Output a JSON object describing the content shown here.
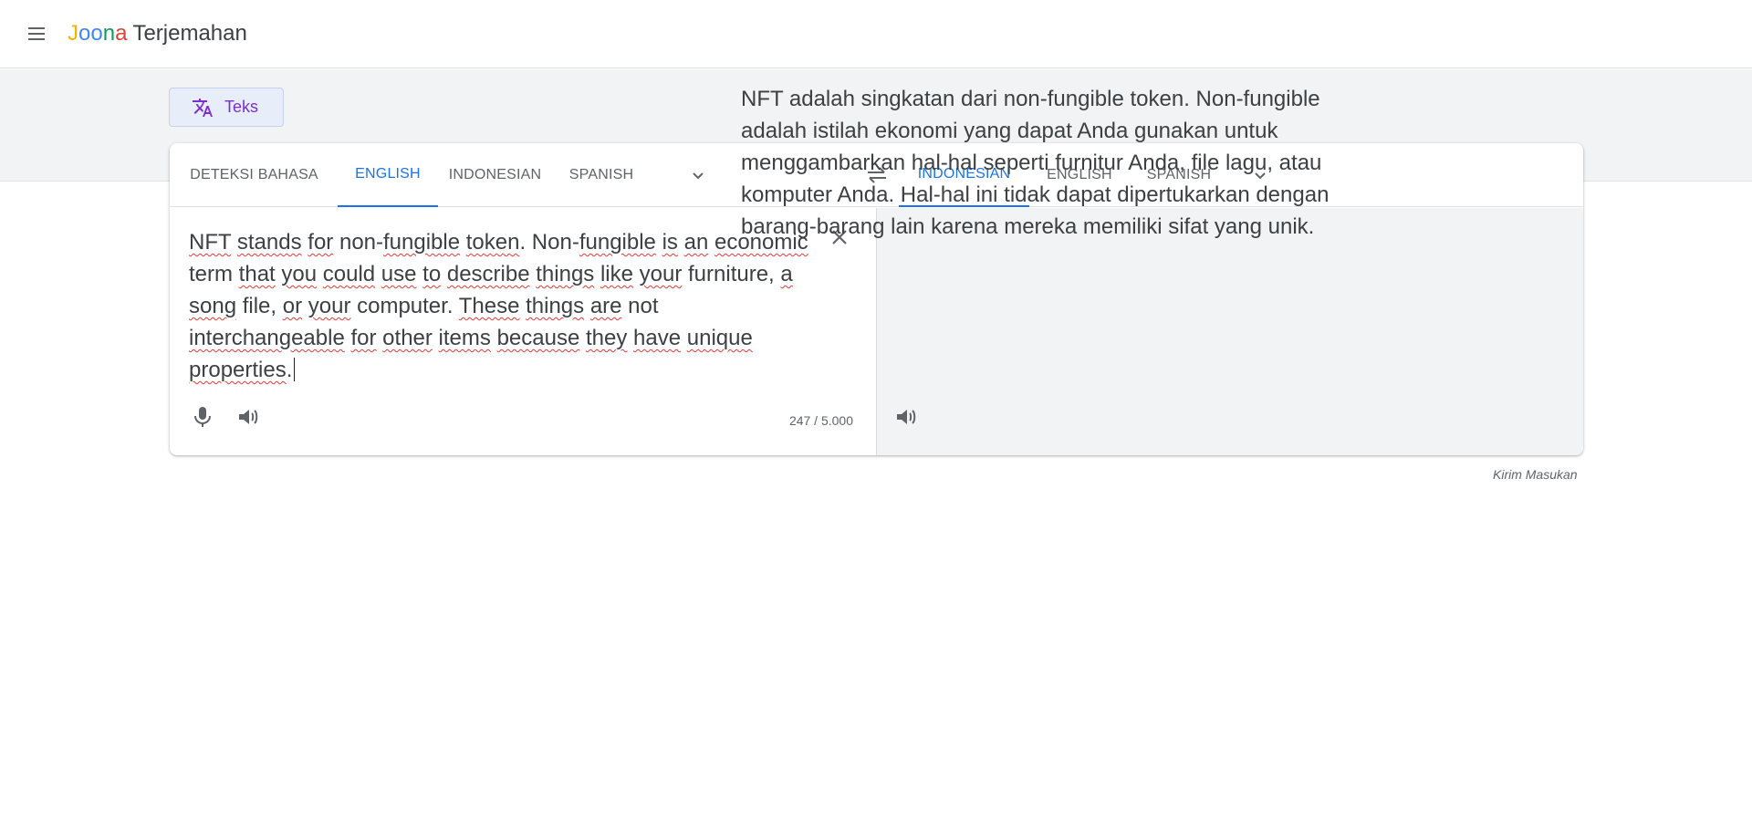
{
  "app": {
    "logo_letters": [
      "J",
      "o",
      "o",
      "n",
      "a"
    ],
    "logo_rest": "Terjemahan",
    "logo_colors": [
      "#f4b400",
      "#4285f4",
      "#0f9d58",
      "#db4437"
    ]
  },
  "mode": {
    "label": "Teks",
    "icon": "translate-icon"
  },
  "source_languages": {
    "tabs": [
      "DETEKSI BAHASA",
      "ENGLISH",
      "INDONESIAN",
      "SPANISH"
    ],
    "active": "ENGLISH"
  },
  "target_languages": {
    "tabs": [
      "INDONESIAN",
      "ENGLISH",
      "SPANISH"
    ],
    "active": "INDONESIAN"
  },
  "source": {
    "words": [
      {
        "t": "NFT",
        "u": true
      },
      {
        "t": " "
      },
      {
        "t": "stands",
        "u": true
      },
      {
        "t": " "
      },
      {
        "t": "for",
        "u": true
      },
      {
        "t": " non-"
      },
      {
        "t": "fungible",
        "u": true
      },
      {
        "t": " "
      },
      {
        "t": "token",
        "u": true
      },
      {
        "t": ". Non-"
      },
      {
        "t": "fungible",
        "u": true
      },
      {
        "t": " "
      },
      {
        "t": "is",
        "u": true
      },
      {
        "t": " "
      },
      {
        "t": "an",
        "u": true
      },
      {
        "t": " "
      },
      {
        "t": "economic",
        "u": true
      },
      {
        "t": " term "
      },
      {
        "t": "that",
        "u": true
      },
      {
        "t": " "
      },
      {
        "t": "you",
        "u": true
      },
      {
        "t": " "
      },
      {
        "t": "could",
        "u": true
      },
      {
        "t": " "
      },
      {
        "t": "use",
        "u": true
      },
      {
        "t": " "
      },
      {
        "t": "to",
        "u": true
      },
      {
        "t": " "
      },
      {
        "t": "describe",
        "u": true
      },
      {
        "t": " "
      },
      {
        "t": "things",
        "u": true
      },
      {
        "t": " "
      },
      {
        "t": "like",
        "u": true
      },
      {
        "t": " "
      },
      {
        "t": "your",
        "u": true
      },
      {
        "t": " "
      },
      {
        "t": "furniture, "
      },
      {
        "t": "a",
        "u": true
      },
      {
        "t": " "
      },
      {
        "t": "song",
        "u": true
      },
      {
        "t": " file, "
      },
      {
        "t": "or",
        "u": true
      },
      {
        "t": " "
      },
      {
        "t": "your",
        "u": true
      },
      {
        "t": " computer. "
      },
      {
        "t": "These",
        "u": true
      },
      {
        "t": " "
      },
      {
        "t": "things",
        "u": true
      },
      {
        "t": " "
      },
      {
        "t": "are",
        "u": true
      },
      {
        "t": " not "
      },
      {
        "t": "interchangeable",
        "u": true
      },
      {
        "t": " "
      },
      {
        "t": "for",
        "u": true
      },
      {
        "t": " "
      },
      {
        "t": "other",
        "u": true
      },
      {
        "t": " "
      },
      {
        "t": "items",
        "u": true
      },
      {
        "t": " "
      },
      {
        "t": "because",
        "u": true
      },
      {
        "t": " "
      },
      {
        "t": "they",
        "u": true
      },
      {
        "t": " "
      },
      {
        "t": "have",
        "u": true
      },
      {
        "t": " "
      },
      {
        "t": "unique",
        "u": true
      },
      {
        "t": " "
      },
      {
        "t": "properties",
        "u": true
      },
      {
        "t": "."
      }
    ],
    "char_count": "247 / 5.000"
  },
  "target": {
    "text": "NFT adalah singkatan dari non-fungible token. Non-fungible adalah istilah ekonomi yang dapat Anda gunakan untuk menggambarkan hal-hal seperti furnitur Anda, file lagu, atau komputer Anda. Hal-hal ini tidak dapat dipertukarkan dengan barang-barang lain karena mereka memiliki sifat yang unik."
  },
  "feedback_label": "Kirim Masukan",
  "colors": {
    "accent": "#1a73e8",
    "mode_text": "#7b2fd1",
    "spell_underline": "#e53935"
  }
}
